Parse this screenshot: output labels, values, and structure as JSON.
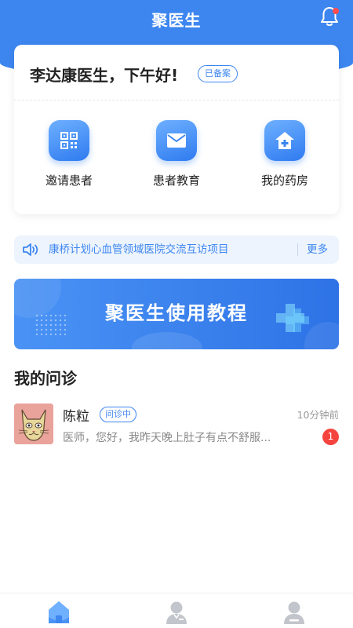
{
  "app": {
    "title": "聚医生"
  },
  "greeting": {
    "text": "李达康医生，下午好!",
    "badge": "已备案"
  },
  "quick_actions": [
    {
      "label": "邀请患者",
      "icon": "qr-code-icon"
    },
    {
      "label": "患者教育",
      "icon": "mail-icon"
    },
    {
      "label": "我的药房",
      "icon": "pharmacy-icon"
    }
  ],
  "notice": {
    "text": "康桥计划心血管领域医院交流互访项目",
    "more": "更多"
  },
  "banner": {
    "title": "聚医生使用教程"
  },
  "section": {
    "title": "我的问诊"
  },
  "consultations": [
    {
      "name": "陈粒",
      "status": "问诊中",
      "time": "10分钟前",
      "message": "医师，您好，我昨天晚上肚子有点不舒服...",
      "unread": "1"
    }
  ],
  "bottom_nav": [
    {
      "name": "home",
      "active": true
    },
    {
      "name": "doctor",
      "active": false
    },
    {
      "name": "profile",
      "active": false
    }
  ],
  "colors": {
    "primary": "#3d86f0",
    "unread": "#f5443e",
    "text": "#222222",
    "muted": "#888888"
  }
}
